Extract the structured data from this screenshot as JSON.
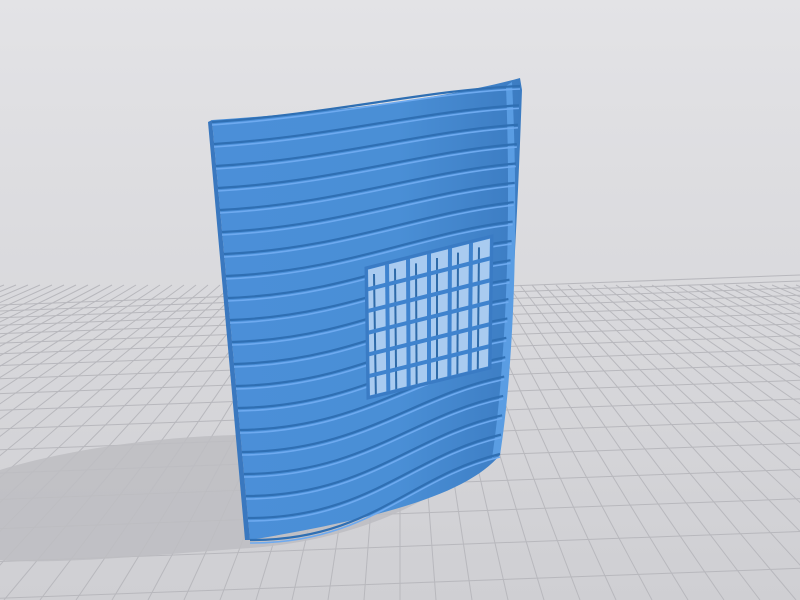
{
  "scene": {
    "background_color": "#d9d9dc",
    "grid_color": "#b8b8bd",
    "shadow_color": "#bcbcc0",
    "part_color": "#4a8fd6",
    "part_highlight_color": "#6eaaf0",
    "part_rib_shadow_color": "#2f6fb3",
    "mesh_color": "#3f83ce",
    "part": {
      "ribs": 20,
      "mesh_columns": 6,
      "mesh_rows": 6
    }
  }
}
